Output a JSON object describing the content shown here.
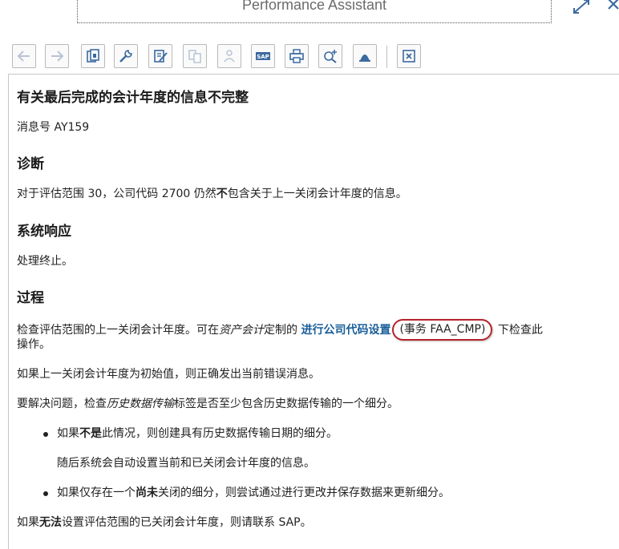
{
  "window": {
    "title": "Performance Assistant"
  },
  "toolbar": {
    "buttons": [
      "back-arrow-icon",
      "forward-arrow-icon",
      "copy-document-icon",
      "wrench-icon",
      "edit-document-icon",
      "document-links-icon",
      "person-settings-icon",
      "sap-icon",
      "print-icon",
      "zoom-in-icon",
      "bell-shape-icon",
      "close-box-icon"
    ]
  },
  "doc": {
    "heading": "有关最后完成的会计年度的信息不完整",
    "message_no": "消息号 AY159",
    "diag_title": "诊断",
    "diag_pre": "对于评估范围 30，公司代码 2700 仍然",
    "diag_bold": "不",
    "diag_post": "包含关于上一关闭会计年度的信息。",
    "resp_title": "系统响应",
    "resp_text": "处理终止。",
    "proc_title": "过程",
    "proc1_a": "检查评估范围的上一关闭会计年度。可在",
    "proc1_ital": "资产会计",
    "proc1_b": "定制的 ",
    "proc1_link": "进行公司代码设置",
    "proc1_circled": "(事务 FAA_CMP)",
    "proc1_c": " 下检查此",
    "proc1_d": "操作。",
    "proc2": "如果上一关闭会计年度为初始值，则正确发出当前错误消息。",
    "proc3_a": "要解决问题，检查",
    "proc3_ital": "历史数据传输",
    "proc3_b": "标签是否至少包含历史数据传输的一个细分。",
    "b1_a": "如果",
    "b1_bold": "不是",
    "b1_b": "此情况，则创建具有历史数据传输日期的细分。",
    "b1_sub": "随后系统会自动设置当前和已关闭会计年度的信息。",
    "b2_a": "如果仅存在一个",
    "b2_bold": "尚未",
    "b2_b": "关闭的细分，则尝试通过进行更改并保存数据来更新细分。",
    "last_a": "如果",
    "last_bold": "无法",
    "last_b": "设置评估范围的已关闭会计年度，则请联系 SAP。"
  },
  "colors": {
    "link": "#1a5f9a",
    "highlight_circle": "#b4222a",
    "button_icon": "#3c6aa0",
    "disabled_icon": "#b7c4d4"
  }
}
